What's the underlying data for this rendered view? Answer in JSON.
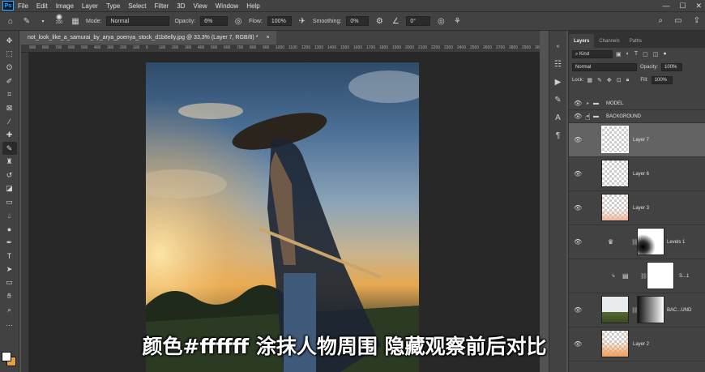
{
  "menu": {
    "logo": "Ps",
    "items": [
      "File",
      "Edit",
      "Image",
      "Layer",
      "Type",
      "Select",
      "Filter",
      "3D",
      "View",
      "Window",
      "Help"
    ]
  },
  "options": {
    "brush_size": "200",
    "mode_label": "Mode:",
    "mode_value": "Normal",
    "opacity_label": "Opacity:",
    "opacity_value": "6%",
    "flow_label": "Flow:",
    "flow_value": "100%",
    "smoothing_label": "Smoothing:",
    "smoothing_value": "0%",
    "angle_value": "0°"
  },
  "document": {
    "tab_title": "not_look_like_a_samurai_by_arya_poenya_stock_d1b8elly.jpg @ 33,3% (Layer 7, RGB/8) *",
    "close": "×",
    "ruler_ticks": [
      "900",
      "800",
      "700",
      "600",
      "500",
      "400",
      "300",
      "200",
      "100",
      "0",
      "100",
      "200",
      "300",
      "400",
      "500",
      "600",
      "700",
      "800",
      "900",
      "1000",
      "1100",
      "1200",
      "1300",
      "1400",
      "1500",
      "1600",
      "1700",
      "1800",
      "1900",
      "2000",
      "2100",
      "2200",
      "2300",
      "2400",
      "2500",
      "2600",
      "2700",
      "2800",
      "2900",
      "3000"
    ]
  },
  "subtitle": "颜色#ffffff 涂抹人物周围 隐藏观察前后对比",
  "colors": {
    "foreground": "#ffffff",
    "background": "#e8a23a"
  },
  "layers_panel": {
    "tabs": [
      "Layers",
      "Channels",
      "Paths"
    ],
    "filter_label": "Kind",
    "blend_mode": "Normal",
    "opacity_label": "Opacity:",
    "opacity_value": "100%",
    "lock_label": "Lock:",
    "fill_label": "Fill:",
    "fill_value": "100%",
    "layers": [
      {
        "name": "MODEL",
        "kind": "group",
        "expanded": false
      },
      {
        "name": "BACKGROUND",
        "kind": "group",
        "expanded": true
      },
      {
        "name": "Layer 7",
        "kind": "pixel",
        "selected": true
      },
      {
        "name": "Layer 6",
        "kind": "pixel"
      },
      {
        "name": "Layer 3",
        "kind": "pixel"
      },
      {
        "name": "Levels 1",
        "kind": "adjustment"
      },
      {
        "name": "S...1",
        "kind": "smart"
      },
      {
        "name": "BAC...UND",
        "kind": "pixel-mask"
      },
      {
        "name": "Layer 2",
        "kind": "pixel"
      }
    ]
  }
}
